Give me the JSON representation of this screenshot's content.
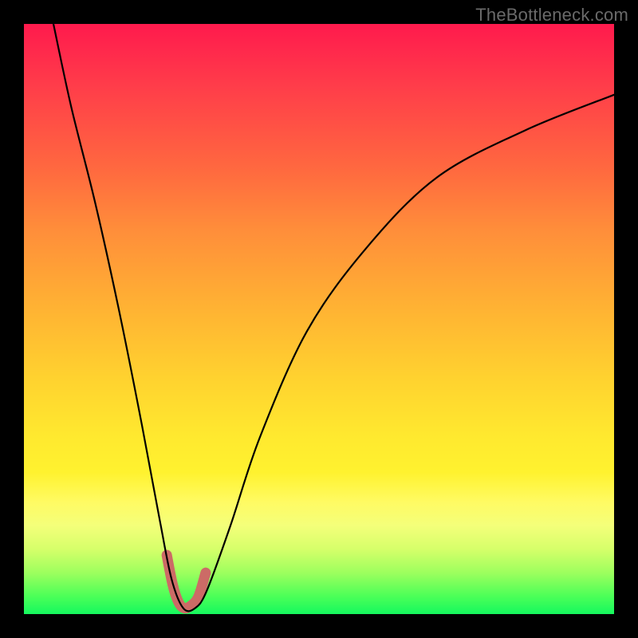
{
  "watermark": "TheBottleneck.com",
  "chart_data": {
    "type": "line",
    "title": "",
    "xlabel": "",
    "ylabel": "",
    "xlim": [
      0,
      100
    ],
    "ylim": [
      0,
      100
    ],
    "series": [
      {
        "name": "bottleneck-curve",
        "x": [
          5,
          8,
          12,
          16,
          20,
          23,
          25,
          27,
          29,
          31,
          35,
          40,
          48,
          58,
          70,
          85,
          100
        ],
        "y": [
          100,
          86,
          70,
          52,
          32,
          16,
          6,
          1,
          1,
          4,
          15,
          30,
          48,
          62,
          74,
          82,
          88
        ]
      }
    ],
    "highlight": {
      "name": "valley-marker",
      "x": [
        24.2,
        25.2,
        26.2,
        27.2,
        28.4,
        29.6,
        30.8
      ],
      "y": [
        10,
        5,
        2,
        1,
        1.5,
        3,
        7
      ]
    },
    "background_gradient": [
      "#ff1a4d",
      "#ffb233",
      "#fff22f",
      "#15f85e"
    ]
  }
}
